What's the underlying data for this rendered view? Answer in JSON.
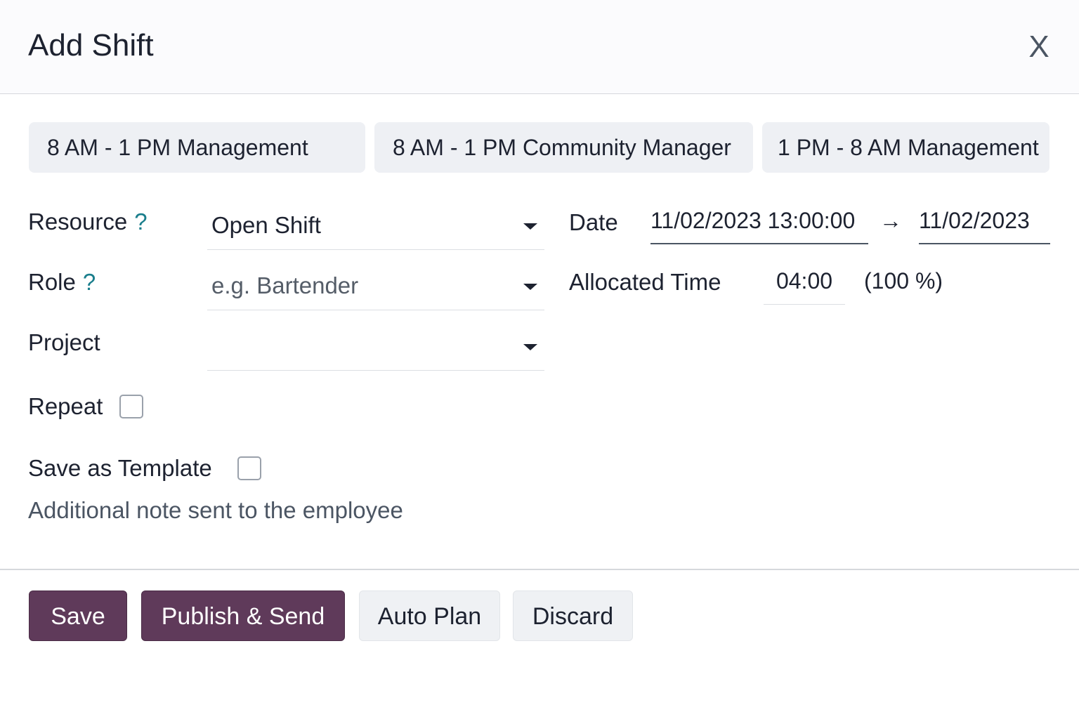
{
  "dialog": {
    "title": "Add Shift",
    "close_label": "X"
  },
  "templates": [
    "8 AM - 1 PM Management",
    "8 AM - 1 PM Community Manager",
    "1 PM - 8 AM Management"
  ],
  "form": {
    "resource": {
      "label": "Resource",
      "help": "?",
      "value": "Open Shift"
    },
    "role": {
      "label": "Role",
      "help": "?",
      "placeholder": "e.g. Bartender",
      "value": ""
    },
    "project": {
      "label": "Project",
      "value": ""
    },
    "repeat": {
      "label": "Repeat",
      "checked": false
    },
    "save_as_template": {
      "label": "Save as Template",
      "checked": false
    },
    "note_placeholder": "Additional note sent to the employee",
    "date": {
      "label": "Date",
      "start": "11/02/2023 13:00:00",
      "arrow": "→",
      "end": "11/02/2023"
    },
    "allocated_time": {
      "label": "Allocated Time",
      "value": "04:00",
      "percentage": "(100 %)"
    }
  },
  "footer": {
    "save_label": "Save",
    "publish_label": "Publish & Send",
    "auto_plan_label": "Auto Plan",
    "discard_label": "Discard"
  },
  "colors": {
    "primary": "#5f3a5a",
    "help": "#1a7e8c"
  }
}
